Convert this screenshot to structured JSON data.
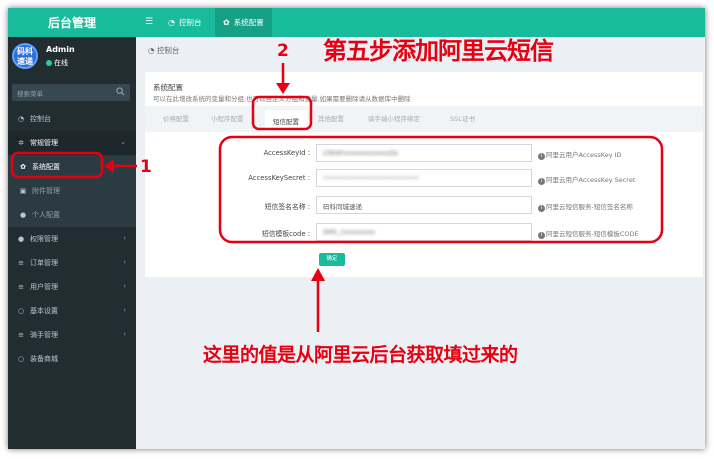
{
  "app": {
    "brand": "后台管理"
  },
  "user": {
    "avatar_text": [
      "码科",
      "速递"
    ],
    "name": "Admin",
    "status": "在线"
  },
  "search": {
    "placeholder": "搜索菜单"
  },
  "sidebar": {
    "items": [
      {
        "label": "控制台",
        "icon": "dashboard-icon"
      },
      {
        "label": "常规管理",
        "icon": "cogs-icon"
      },
      {
        "label": "系统配置",
        "icon": "gear-icon"
      },
      {
        "label": "附件管理",
        "icon": "file-image-icon"
      },
      {
        "label": "个人配置",
        "icon": "user-icon"
      },
      {
        "label": "权限管理",
        "icon": "group-icon"
      },
      {
        "label": "订单管理",
        "icon": "list-icon"
      },
      {
        "label": "用户管理",
        "icon": "list-icon"
      },
      {
        "label": "基本设置",
        "icon": "circle-icon"
      },
      {
        "label": "骑手管理",
        "icon": "list-icon"
      },
      {
        "label": "装备商城",
        "icon": "circle-icon"
      }
    ]
  },
  "topbar": {
    "tabs": [
      {
        "label": "控制台",
        "icon": "dashboard-icon"
      },
      {
        "label": "系统配置",
        "icon": "gear-icon"
      }
    ]
  },
  "breadcrumb": {
    "label": "控制台"
  },
  "panel": {
    "title": "系统配置",
    "subtitle": "可以在此增改系统的变量和分组,也可以自定义分组和变量,如果需要删除请从数据库中删除",
    "tabs": [
      "价格配置",
      "小程序配置",
      "短信配置",
      "其他配置",
      "骑手端小程序绑定",
      "SSL证书"
    ],
    "active_tab": "短信配置",
    "fields": [
      {
        "label": "AccessKeyId :",
        "value": "LTAI4FxxxxxxxxxxxxZe",
        "help": "阿里云用户AccessKey ID"
      },
      {
        "label": "AccessKeySecret :",
        "value": "•••••••••••••••••••••••••",
        "help": "阿里云用户AccessKey Secret"
      },
      {
        "label": "短信签名名称 :",
        "value": "码科同城速递",
        "help": "阿里云短信服务-短信签名名称"
      },
      {
        "label": "短信模板code :",
        "value": "SMS_1xxxxxxxx",
        "help": "阿里云短信服务-短信模板CODE"
      }
    ],
    "submit_label": "确定"
  },
  "annotations": {
    "title": "第五步添加阿里云短信",
    "bottom": "这里的值是从阿里云后台获取填过来的",
    "step1": "1",
    "step2": "2",
    "color": "#e60012"
  },
  "colors": {
    "accent": "#18bc9c",
    "sidebar": "#222d32"
  }
}
